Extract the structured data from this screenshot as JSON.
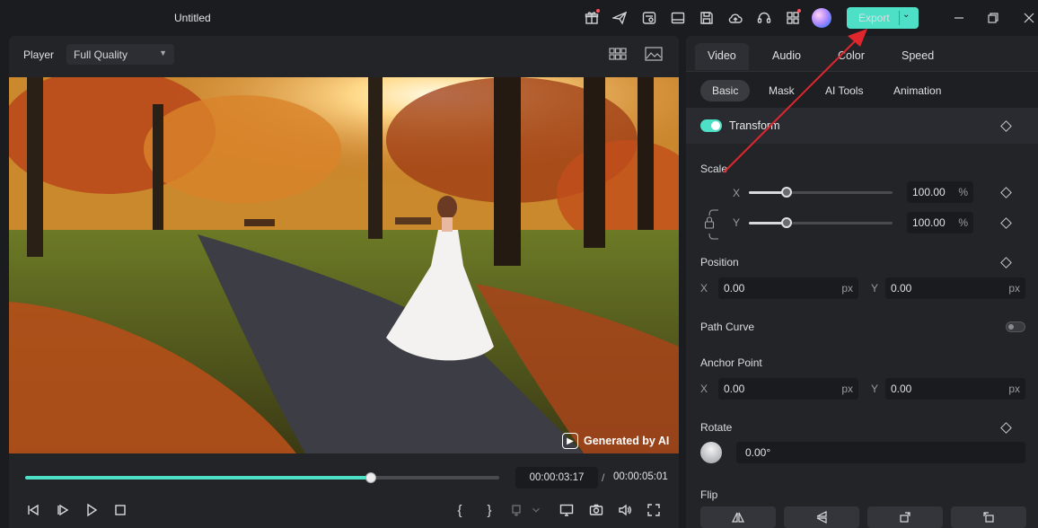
{
  "app": {
    "title": "Untitled"
  },
  "toolbar": {
    "icons": [
      "gift-icon",
      "send-icon",
      "settings-card-icon",
      "monitor-icon",
      "save-icon",
      "cloud-upload-icon",
      "headset-icon",
      "apps-grid-icon"
    ],
    "export_label": "Export",
    "accent": "#4ee0c7"
  },
  "player": {
    "label": "Player",
    "quality": "Full Quality",
    "current_time": "00:00:03:17",
    "separator": "/",
    "total_time": "00:00:05:01",
    "progress": 0.73,
    "watermark": "Generated by AI",
    "controls": {
      "mark_in": "{",
      "mark_out": "}"
    }
  },
  "panel": {
    "tabs": [
      "Video",
      "Audio",
      "Color",
      "Speed"
    ],
    "subtabs": [
      "Basic",
      "Mask",
      "AI Tools",
      "Animation"
    ],
    "transform": {
      "title": "Transform",
      "scale_label": "Scale",
      "scale_x_axis": "X",
      "scale_y_axis": "Y",
      "scale_x": "100.00",
      "scale_y": "100.00",
      "scale_unit": "%",
      "scale_level": 0.26,
      "position_label": "Position",
      "pos_x_axis": "X",
      "pos_y_axis": "Y",
      "pos_x": "0.00",
      "pos_y": "0.00",
      "px_unit": "px",
      "path_curve_label": "Path Curve",
      "anchor_label": "Anchor Point",
      "anchor_x_axis": "X",
      "anchor_y_axis": "Y",
      "anchor_x": "0.00",
      "anchor_y": "0.00",
      "rotate_label": "Rotate",
      "rotate_value": "0.00°",
      "flip_label": "Flip"
    }
  }
}
